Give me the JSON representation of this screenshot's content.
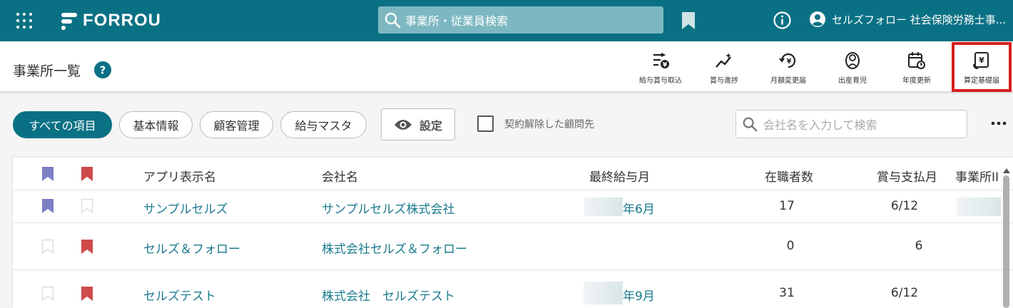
{
  "header": {
    "brand": "FORROU",
    "search_placeholder": "事業所・従業員検索",
    "user_name": "セルズフォロー 社会保険労務士事..."
  },
  "toolbar": {
    "title": "事業所一覧",
    "tools": [
      {
        "label": "給与賞与取込",
        "icon": "import-yen-icon"
      },
      {
        "label": "賞与進捗",
        "icon": "progress-chart-icon"
      },
      {
        "label": "月額変更届",
        "icon": "monthly-change-yen-icon"
      },
      {
        "label": "出産育児",
        "icon": "baby-icon"
      },
      {
        "label": "年度更新",
        "icon": "calendar-renew-icon"
      },
      {
        "label": "算定基礎届",
        "icon": "calc-yen-icon",
        "selected": true
      }
    ]
  },
  "filters": {
    "chips": [
      "すべての項目",
      "基本情報",
      "顧客管理",
      "給与マスタ"
    ],
    "active_chip": "すべての項目",
    "settings_label": "設定",
    "checkbox_label": "契約解除した顧問先",
    "search_placeholder": "会社名を入力して検索"
  },
  "table": {
    "columns": [
      "アプリ表示名",
      "会社名",
      "最終給与月",
      "在職者数",
      "賞与支払月",
      "事業所II"
    ],
    "rows": [
      {
        "app_name": "サンプルセルズ",
        "company": "サンプルセルズ株式会社",
        "last_pay_month": "年6月",
        "employees": "17",
        "bonus_month": "6/12",
        "bookmark_blue": true,
        "bookmark_red": false
      },
      {
        "app_name": "セルズ＆フォロー",
        "company": "株式会社セルズ＆フォロー",
        "last_pay_month": "",
        "employees": "0",
        "bonus_month": "6",
        "bookmark_blue": false,
        "bookmark_red": true
      },
      {
        "app_name": "セルズテスト",
        "company": "株式会社　セルズテスト",
        "last_pay_month": "年9月",
        "employees": "31",
        "bonus_month": "6/12",
        "bookmark_blue": false,
        "bookmark_red": true
      }
    ]
  },
  "colors": {
    "brand": "#0a7184",
    "bookmark_blue": "#7b7fc4",
    "bookmark_red": "#cf4a4a",
    "highlight": "#d71e1e"
  }
}
